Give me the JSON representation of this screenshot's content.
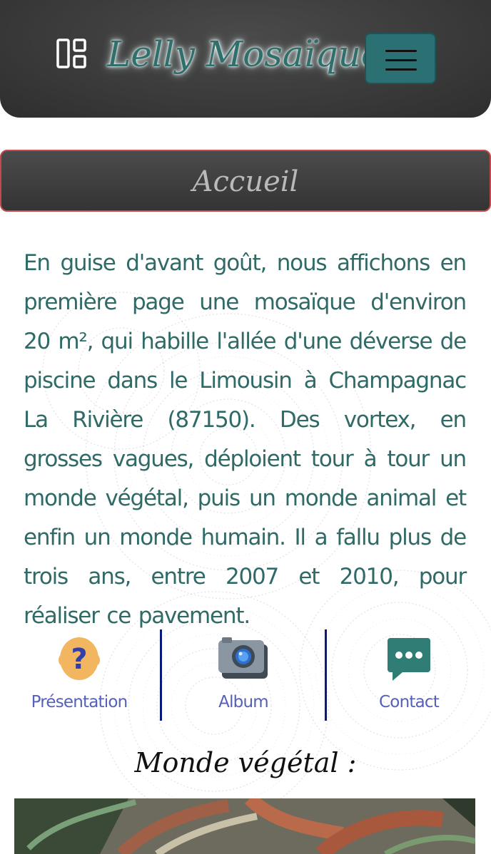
{
  "header": {
    "brand": "Lelly Mosaïque",
    "dashboard_icon": "dashboard-icon",
    "menu_icon": "hamburger-icon"
  },
  "page": {
    "title": "Accueil"
  },
  "intro": {
    "text": "En guise d'avant goût, nous affichons en première page une mosaïque d'environ 20 m², qui habille l'allée d'une déverse de piscine dans le Limousin à Champagnac La Rivière (87150). Des vortex, en grosses vagues, déploient tour à tour un monde végétal, puis un monde animal et enfin un monde humain. Il a fallu plus de trois ans, entre 2007 et 2010, pour réaliser ce pavement."
  },
  "nav": {
    "items": [
      {
        "label": "Présentation",
        "icon": "question-icon"
      },
      {
        "label": "Album",
        "icon": "camera-icon"
      },
      {
        "label": "Contact",
        "icon": "chat-icon"
      }
    ]
  },
  "section": {
    "title": "Monde végétal :"
  },
  "colors": {
    "header_bg": "#3a3a3a",
    "brand_text": "#2f6f6c",
    "menu_button": "#2b7073",
    "title_border": "#c44a4a",
    "body_text": "#2f6a66",
    "nav_label": "#5560b8",
    "divider": "#0a1a7a"
  }
}
